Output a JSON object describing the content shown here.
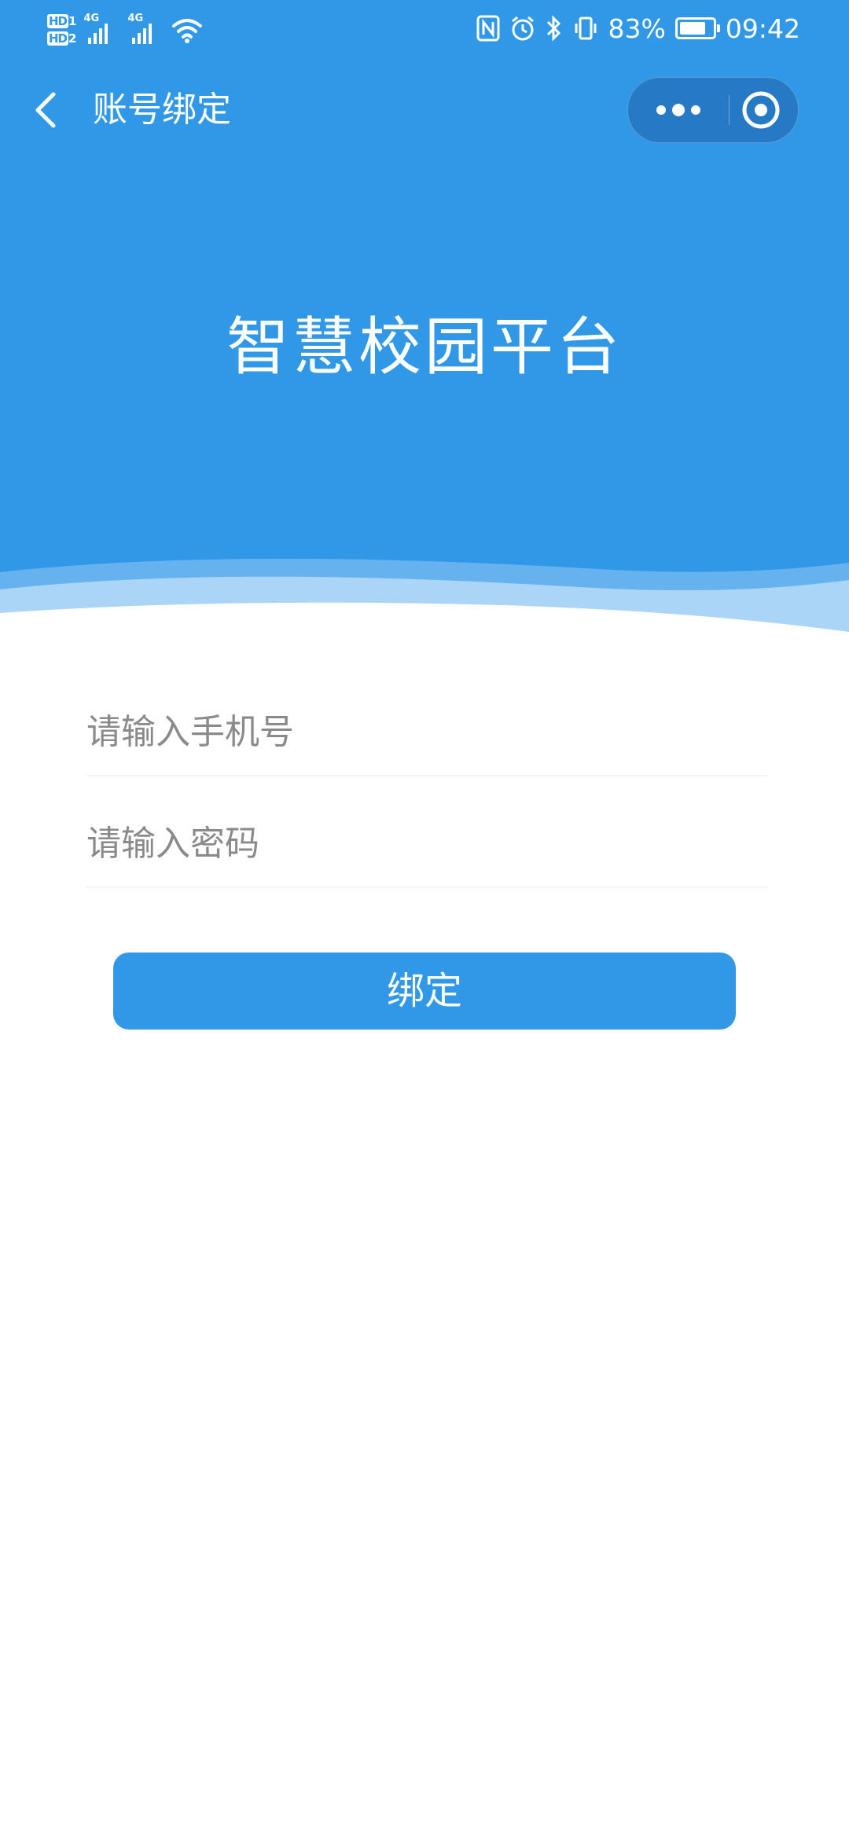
{
  "status_bar": {
    "hd1": "HD",
    "hd1_num": "1",
    "hd2": "HD",
    "hd2_num": "2",
    "network1": "4G",
    "network2": "4G",
    "nfc": "N",
    "battery_percent": "83%",
    "battery_level": 0.83,
    "time": "09:42",
    "icons": [
      "signal-icon",
      "wifi-icon",
      "nfc-icon",
      "alarm-icon",
      "bluetooth-icon",
      "vibrate-icon",
      "battery-icon"
    ]
  },
  "nav": {
    "back_icon": "chevron-left-icon",
    "title": "账号绑定",
    "capsule": {
      "more_icon": "more-dots-icon",
      "close_icon": "target-close-icon"
    }
  },
  "hero": {
    "title": "智慧校园平台"
  },
  "form": {
    "phone_placeholder": "请输入手机号",
    "phone_value": "",
    "password_placeholder": "请输入密码",
    "password_value": "",
    "submit_label": "绑定"
  },
  "colors": {
    "primary": "#3198e8",
    "background": "#ffffff",
    "placeholder": "#8a8a8a",
    "divider": "#f1f3f6"
  }
}
